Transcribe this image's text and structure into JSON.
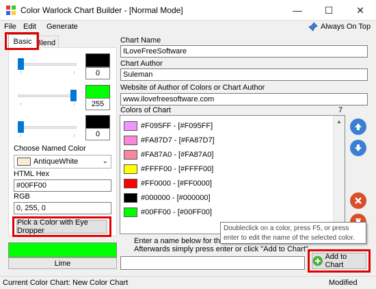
{
  "window": {
    "title": "Color Warlock Chart Builder - [Normal Mode]",
    "minimize": "—",
    "maximize": "☐",
    "close": "✕"
  },
  "menu": {
    "file": "File",
    "edit": "Edit",
    "generate": "Generate",
    "always_on_top": "Always On Top"
  },
  "tabs": [
    {
      "label": "Basic",
      "active": true
    },
    {
      "label": "Blend",
      "active": false
    }
  ],
  "sliders": [
    {
      "channel": "red",
      "value": "0",
      "swatch_color": "#000000",
      "fraction": 0.0
    },
    {
      "channel": "green",
      "value": "255",
      "swatch_color": "#00FF00",
      "fraction": 1.0
    },
    {
      "channel": "blue",
      "value": "0",
      "swatch_color": "#000000",
      "fraction": 0.0
    }
  ],
  "named_color": {
    "label": "Choose Named Color",
    "value": "AntiqueWhite",
    "swatch_color": "#FAEBD7"
  },
  "html_hex": {
    "label": "HTML Hex",
    "value": "#00FF00"
  },
  "rgb": {
    "label": "RGB",
    "value": "0, 255, 0"
  },
  "eye_dropper_button": "Pick a Color with Eye Dropper",
  "preview": {
    "color": "#00FF00",
    "name": "Lime"
  },
  "chart_name": {
    "label": "Chart Name",
    "value": "ILoveFreeSoftware"
  },
  "chart_author": {
    "label": "Chart Author",
    "value": "Suleman"
  },
  "website": {
    "label": "Website of Author of Colors or Chart Author",
    "value": "www.ilovefreesoftware.com"
  },
  "colors_of_chart": {
    "label": "Colors of Chart",
    "count": "7",
    "items": [
      {
        "text": "#F095FF - [#F095FF]",
        "color": "#F095FF"
      },
      {
        "text": "#FA87D7 - [#FA87D7]",
        "color": "#FA87D7"
      },
      {
        "text": "#FA87A0 - [#FA87A0]",
        "color": "#FA87A0"
      },
      {
        "text": "#FFFF00 - [#FFFF00]",
        "color": "#FFFF00"
      },
      {
        "text": "#FF0000 - [#FF0000]",
        "color": "#FF0000"
      },
      {
        "text": "#000000 - [#000000]",
        "color": "#000000"
      },
      {
        "text": "#00FF00 - [#00FF00]",
        "color": "#00FF00"
      }
    ]
  },
  "side_buttons": {
    "up_color": "#3a7fd5",
    "down_color": "#3a7fd5",
    "remove_color": "#d8502a",
    "clear_color": "#d8502a"
  },
  "tooltip": {
    "line1": "Doubleclick on a color, press F5, or press",
    "line2": "enter to edit the name of the selected color."
  },
  "instructions": {
    "line1": "Enter a name below for the colo",
    "line2": "Afterwards simply press enter or click \"Add to Chart\"."
  },
  "add_name_input": {
    "value": ""
  },
  "add_to_chart_button": "Add to Chart",
  "status": {
    "label": "Current Color Chart:",
    "chart": "New Color Chart",
    "state": "Modified"
  },
  "highlight_color": "#E00000",
  "accent_color": "#0078D7"
}
